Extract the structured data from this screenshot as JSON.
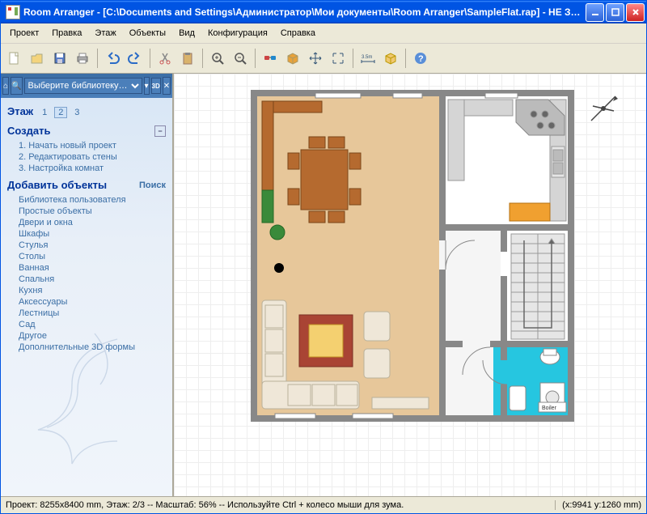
{
  "title": "Room Arranger - [C:\\Documents and Settings\\Администратор\\Мои документы\\Room Arranger\\SampleFlat.rap] - НЕ ЗАРЕГИСТРИРО…",
  "menu": {
    "project": "Проект",
    "edit": "Правка",
    "floor": "Этаж",
    "objects": "Объекты",
    "view": "Вид",
    "config": "Конфигурация",
    "help": "Справка"
  },
  "searchbar": {
    "placeholder": "Выберите библиотеку…",
    "badge3d": "3D"
  },
  "sidebar": {
    "floor_label": "Этаж",
    "floors": [
      "1",
      "2",
      "3"
    ],
    "active_floor": "2",
    "create_header": "Создать",
    "steps": [
      "1. Начать новый проект",
      "2. Редактировать стены",
      "3. Настройка комнат"
    ],
    "addobj_header": "Добавить объекты",
    "search_link": "Поиск",
    "categories": [
      "Библиотека пользователя",
      "Простые объекты",
      "Двери и окна",
      "Шкафы",
      "Стулья",
      "Столы",
      "Ванная",
      "Спальня",
      "Кухня",
      "Аксессуары",
      "Лестницы",
      "Сад",
      "Другое",
      "Дополнительные 3D формы"
    ]
  },
  "icons": {
    "new": "new-icon",
    "open": "open-icon",
    "save": "save-icon",
    "print": "print-icon",
    "undo": "undo-icon",
    "redo": "redo-icon",
    "cut": "cut-icon",
    "paste": "paste-icon",
    "zoomin": "zoom-in-icon",
    "zoomout": "zoom-out-icon",
    "view3d": "3d-view-icon",
    "box": "box-icon",
    "move": "move-icon",
    "expand": "expand-icon",
    "measure": "measure-icon",
    "furniture": "furniture-icon",
    "help": "help-icon"
  },
  "status": {
    "left": "Проект: 8255x8400 mm, Этаж: 2/3 -- Масштаб: 56% -- Используйте Ctrl + колесо мыши для зума.",
    "right": "(x:9941 y:1260 mm)"
  },
  "bathroom_label": "Boiler"
}
